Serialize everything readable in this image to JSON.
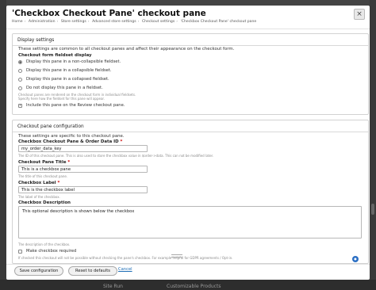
{
  "dialog": {
    "title": "'Checkbox Checkout Pane' checkout pane",
    "breadcrumb": [
      "Home",
      "Administration",
      "Store settings",
      "Advanced store settings",
      "Checkout settings",
      "'Checkbox Checkout Pane' checkout pane"
    ]
  },
  "display_settings": {
    "legend": "Display settings",
    "intro": "These settings are common to all checkout panes and affect their appearance on the checkout form.",
    "group_label": "Checkout form fieldset display",
    "options": [
      {
        "label": "Display this pane in a non-collapsible fieldset.",
        "selected": true
      },
      {
        "label": "Display this pane in a collapsible fieldset.",
        "selected": false
      },
      {
        "label": "Display this pane in a collapsed fieldset.",
        "selected": false
      },
      {
        "label": "Do not display this pane in a fieldset.",
        "selected": false
      }
    ],
    "options_desc_1": "Checkout panes are rendered on the checkout form in individual fieldsets.",
    "options_desc_2": "Specify here how the fieldset for this pane will appear.",
    "review_label": "Include this pane on the Review checkout pane.",
    "review_checked": true
  },
  "pane_config": {
    "legend": "Checkout pane configuration",
    "intro": "These settings are specific to this checkout pane.",
    "id_label": "Checkbox Checkout Pane & Order Data ID",
    "id_value": "my_order_data_key",
    "id_desc": "The ID of this checkout pane. This is also used to store the checkbox value in $order->data. This can not be modified later.",
    "title_label": "Checkout Pane Title",
    "title_value": "This is a checkbox pane",
    "title_desc": "The title of this checkout pane.",
    "cb_label_label": "Checkbox Label",
    "cb_label_value": "This is the checkbox label",
    "cb_label_desc": "The label of the checkbox.",
    "description_label": "Checkbox Description",
    "description_value": "This optional description is shown below the checkbox",
    "description_desc": "The description of the checkbox.",
    "required_label": "Make checkbox required",
    "required_checked": false,
    "required_desc": "If checked this checkout will not be possible without checking the pane's checkbox. For example helpful for GDPR agreements / Opt-in.",
    "required_mark": "*"
  },
  "footer": {
    "save_label": "Save configuration",
    "reset_label": "Reset to defaults",
    "cancel_label": "Cancel"
  },
  "background": {
    "tab_left": "Site Run",
    "tab_right": "Customizable Products"
  },
  "icons": {
    "close": "close-icon",
    "chat": "chat-icon"
  }
}
